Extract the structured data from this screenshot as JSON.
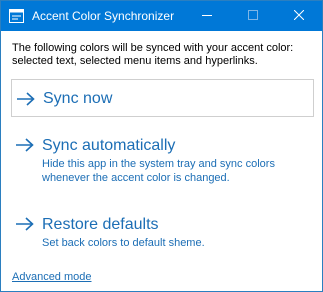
{
  "window": {
    "title": "Accent Color Synchronizer",
    "accent_color": "#0078d7",
    "link_color": "#1c6eb5",
    "controls": [
      "minimize-icon",
      "maximize-icon",
      "close-icon"
    ]
  },
  "intro_text": "The following colors will be synced with your accent color: selected text, selected menu items and hyperlinks.",
  "actions": [
    {
      "icon": "arrow-right-icon",
      "title": "Sync now"
    },
    {
      "icon": "arrow-right-icon",
      "title": "Sync automatically",
      "description": "Hide this app in the system tray and sync colors whenever the accent color is changed."
    },
    {
      "icon": "arrow-right-icon",
      "title": "Restore defaults",
      "description": "Set back colors to default sheme."
    }
  ],
  "advanced_link": "Advanced mode"
}
